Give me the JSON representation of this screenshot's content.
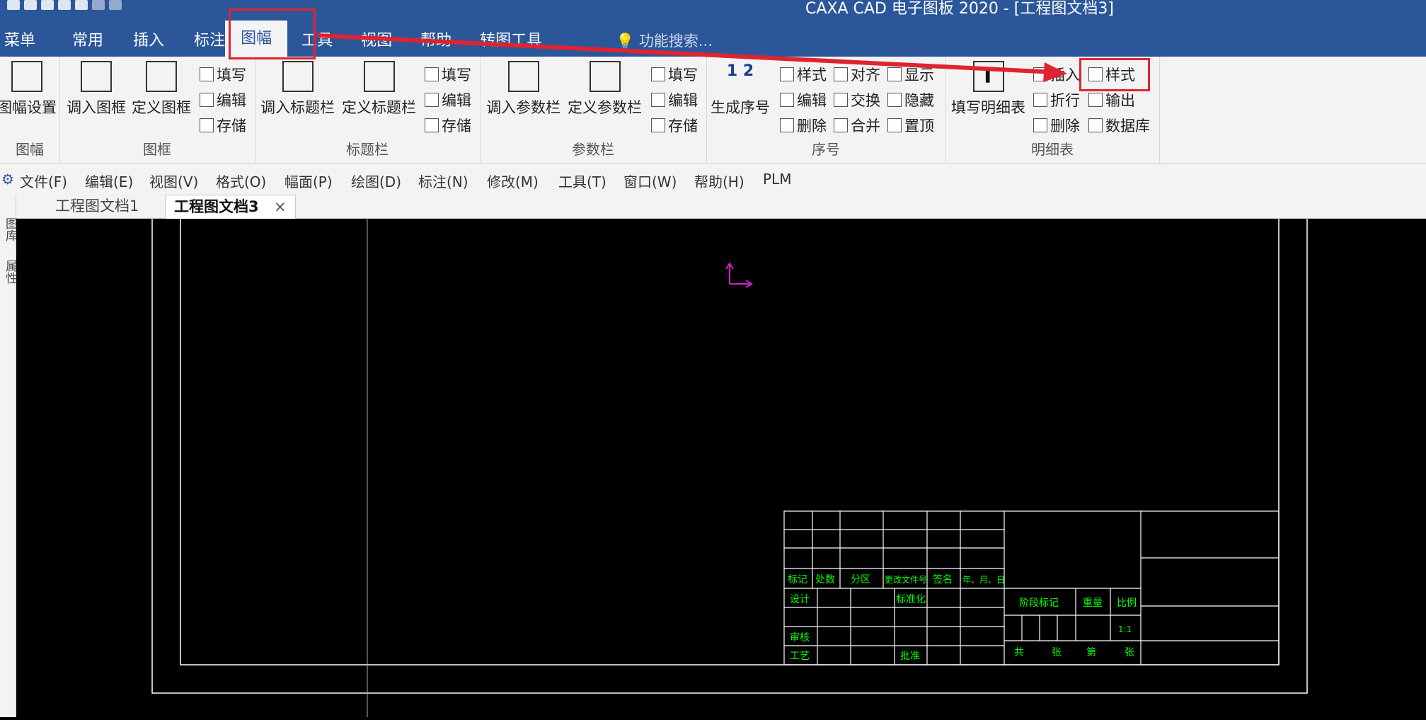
{
  "window": {
    "title": "CAXA CAD 电子图板 2020 - [工程图文档3]"
  },
  "ribbon_tabs": [
    "菜单",
    "常用",
    "插入",
    "标注",
    "图幅",
    "工具",
    "视图",
    "帮助",
    "转图工具"
  ],
  "search_placeholder": "功能搜索...",
  "groups": {
    "tufu": {
      "label": "图幅",
      "buttons": {
        "setup": "图幅设置"
      }
    },
    "tukuang": {
      "label": "图框",
      "buttons": {
        "load": "调入图框",
        "define": "定义图框",
        "fill": "填写",
        "edit": "编辑",
        "save": "存储"
      }
    },
    "biaotilan": {
      "label": "标题栏",
      "buttons": {
        "load": "调入标题栏",
        "define": "定义标题栏",
        "fill": "填写",
        "edit": "编辑",
        "save": "存储"
      }
    },
    "canshulan": {
      "label": "参数栏",
      "buttons": {
        "load": "调入参数栏",
        "define": "定义参数栏",
        "fill": "填写",
        "edit": "编辑",
        "save": "存储"
      }
    },
    "xuhao": {
      "label": "序号",
      "buttons": {
        "generate": "生成序号",
        "generate_icon_text": "1 2",
        "style": "样式",
        "edit": "编辑",
        "delete": "删除",
        "align": "对齐",
        "swap": "交换",
        "merge": "合并",
        "show": "显示",
        "hide": "隐藏",
        "top": "置顶"
      }
    },
    "mingxibiao": {
      "label": "明细表",
      "buttons": {
        "fill": "填写明细表",
        "insert": "插入",
        "fold": "折行",
        "delete": "删除",
        "style": "样式",
        "output": "输出",
        "database": "数据库"
      }
    }
  },
  "menubar": [
    "文件(F)",
    "编辑(E)",
    "视图(V)",
    "格式(O)",
    "幅面(P)",
    "绘图(D)",
    "标注(N)",
    "修改(M)",
    "工具(T)",
    "窗口(W)",
    "帮助(H)",
    "PLM"
  ],
  "doc_tabs": [
    "工程图文档1",
    "工程图文档3"
  ],
  "doc_tab_close": "×",
  "left_panel": [
    "图库",
    "属性"
  ],
  "title_block": {
    "header_row": [
      "标记",
      "处数",
      "分区",
      "更改文件号",
      "签名",
      "年、月、日"
    ],
    "labels": {
      "design": "设计",
      "standard": "标准化",
      "review": "审核",
      "process": "工艺",
      "approve": "批准",
      "stage": "阶段标记",
      "weight": "重量",
      "scale": "比例",
      "scale_value": "1:1",
      "total": "共",
      "sheets": "张",
      "page": "第",
      "sheet2": "张"
    }
  },
  "colors": {
    "ribbon_blue": "#2b579a",
    "highlight_red": "#e0242f",
    "cad_green": "#00ff00",
    "ucs_magenta": "#d020d0"
  }
}
